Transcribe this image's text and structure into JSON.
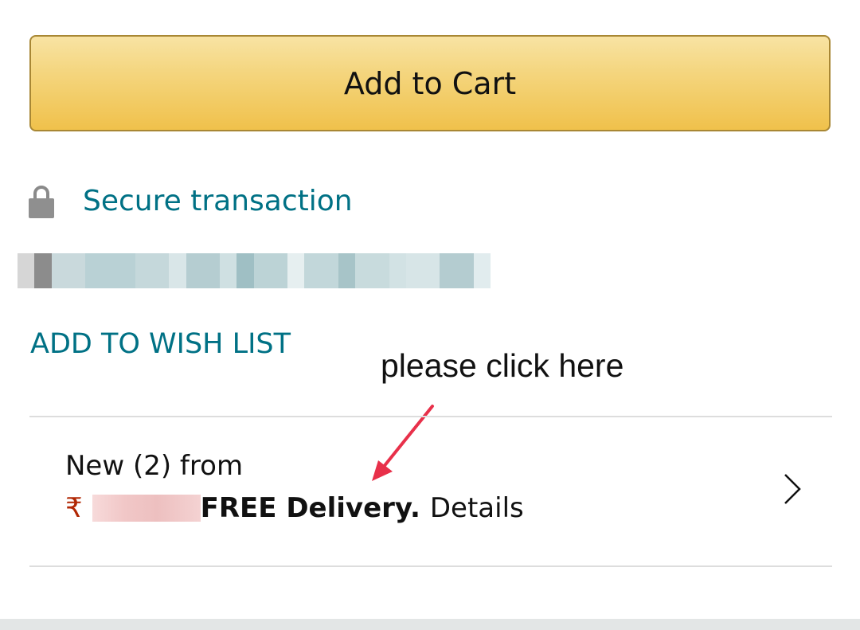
{
  "buy_box": {
    "add_to_cart_label": "Add to Cart",
    "secure_transaction_label": "Secure transaction",
    "wish_list_label": "ADD TO WISH LIST"
  },
  "annotation": {
    "text": "please click here",
    "arrow_color": "#e8304a"
  },
  "offers": {
    "line1": "New (2) from",
    "currency_symbol": "₹",
    "free_delivery": "FREE Delivery.",
    "details": "Details"
  },
  "icons": {
    "lock": "lock-icon",
    "chevron": "chevron-right-icon"
  },
  "colors": {
    "button_top": "#f8e3a3",
    "button_bottom": "#f0c14b",
    "button_border": "#a88734",
    "link": "#007185",
    "price": "#b12704"
  }
}
